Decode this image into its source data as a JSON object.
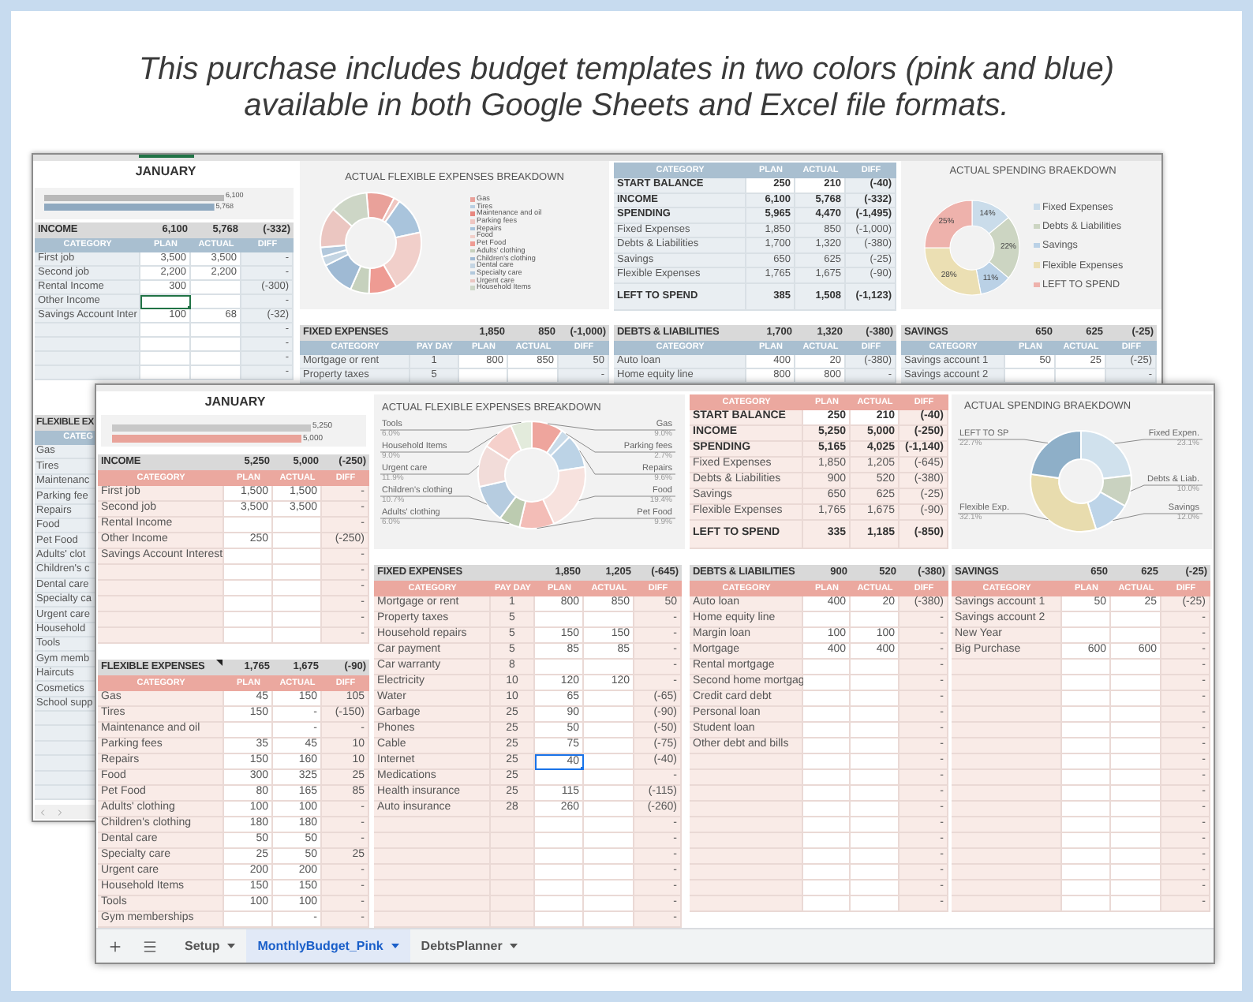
{
  "header": {
    "text": "This purchase includes budget templates in two colors (pink and blue) available in both Google Sheets and Excel file formats."
  },
  "back_sheet": {
    "title": "JANUARY",
    "income_chart": {
      "chart_data": {
        "type": "bar",
        "orientation": "horizontal",
        "categories": [
          null,
          null
        ],
        "values": [
          6100,
          5768
        ],
        "colors": [
          "#b9b9b9",
          "#8fa9c0"
        ],
        "value_labels": [
          "6,100",
          "5,768"
        ]
      }
    },
    "income": {
      "title": "INCOME",
      "totals": [
        "6,100",
        "5,768",
        "(-332)"
      ],
      "columns": [
        "CATEGORY",
        "PLAN",
        "ACTUAL",
        "DIFF"
      ],
      "rows": [
        {
          "category": "First job",
          "plan": "3,500",
          "actual": "3,500",
          "diff": "-"
        },
        {
          "category": "Second job",
          "plan": "2,200",
          "actual": "2,200",
          "diff": "-"
        },
        {
          "category": "Rental Income",
          "plan": "300",
          "diff": "(-300)"
        },
        {
          "category": "Other Income",
          "diff": "-",
          "plan_selected": true
        },
        {
          "category": "Savings Account Inter",
          "plan": "100",
          "actual": "68",
          "diff": "(-32)"
        },
        {
          "diff": "-"
        },
        {
          "diff": "-"
        },
        {
          "diff": "-"
        },
        {
          "diff": "-"
        }
      ]
    },
    "flexible_chart": {
      "title": "ACTUAL FLEXIBLE EXPENSES BREAKDOWN",
      "legend": [
        {
          "label": "Gas",
          "color": "#e9a19a"
        },
        {
          "label": "Tires",
          "color": "#b9cfe2"
        },
        {
          "label": "Maintenance and oil",
          "color": "#e8877f"
        },
        {
          "label": "Parking fees",
          "color": "#efc6c1"
        },
        {
          "label": "Repairs",
          "color": "#a9c4dc"
        },
        {
          "label": "Food",
          "color": "#f1cfca"
        },
        {
          "label": "Pet Food",
          "color": "#ee9b93"
        },
        {
          "label": "Adults' clothing",
          "color": "#c6d1bd"
        },
        {
          "label": "Children's clothing",
          "color": "#9fbad4"
        },
        {
          "label": "Dental care",
          "color": "#c4d5e3"
        },
        {
          "label": "Specialty care",
          "color": "#b2c8dc"
        },
        {
          "label": "Urgent care",
          "color": "#ebc6c1"
        },
        {
          "label": "Household Items",
          "color": "#cdd6c6"
        }
      ]
    },
    "fixed": {
      "title": "FIXED EXPENSES",
      "totals": [
        "1,850",
        "850",
        "(-1,000)"
      ],
      "columns": [
        "CATEGORY",
        "PAY DAY",
        "PLAN",
        "ACTUAL",
        "DIFF"
      ],
      "rows": [
        {
          "category": "Mortgage or rent",
          "pay_day": "1",
          "plan": "800",
          "actual": "850",
          "diff": "50"
        },
        {
          "category": "Property taxes",
          "pay_day": "5",
          "diff": "-"
        }
      ]
    },
    "summary": {
      "columns": [
        "CATEGORY",
        "PLAN",
        "ACTUAL",
        "DIFF"
      ],
      "rows": [
        {
          "kind": "input",
          "category": "START BALANCE",
          "plan": "250",
          "actual": "210",
          "diff": "(-40)"
        },
        {
          "kind": "main",
          "category": "INCOME",
          "plan": "6,100",
          "actual": "5,768",
          "diff": "(-332)"
        },
        {
          "kind": "main",
          "category": "SPENDING",
          "plan": "5,965",
          "actual": "4,470",
          "diff": "(-1,495)"
        },
        {
          "kind": "sub",
          "category": "Fixed Expenses",
          "plan": "1,850",
          "actual": "850",
          "diff": "(-1,000)"
        },
        {
          "kind": "sub",
          "category": "Debts & Liabilities",
          "plan": "1,700",
          "actual": "1,320",
          "diff": "(-380)"
        },
        {
          "kind": "sub",
          "category": "Savings",
          "plan": "650",
          "actual": "625",
          "diff": "(-25)"
        },
        {
          "kind": "sub",
          "category": "Flexible Expenses",
          "plan": "1,765",
          "actual": "1,675",
          "diff": "(-90)"
        },
        {
          "kind": "result",
          "category": "LEFT TO SPEND",
          "plan": "385",
          "actual": "1,508",
          "diff": "(-1,123)"
        }
      ]
    },
    "spending_chart": {
      "title": "ACTUAL SPENDING BRAEKDOWN",
      "chart_data": {
        "type": "donut",
        "legend": "right",
        "categories": [
          "Fixed Expenses",
          "Debts & Liabilities",
          "Savings",
          "Flexible Expenses",
          "LEFT TO SPEND"
        ],
        "values": [
          14,
          22,
          11,
          28,
          25
        ],
        "colors": [
          "#cadcea",
          "#ccd5c2",
          "#bad1e6",
          "#ebdfb3",
          "#eeb2ac"
        ],
        "value_labels": [
          "14%",
          "22%",
          "11%",
          "28%",
          "25%"
        ]
      }
    },
    "debts": {
      "title": "DEBTS & LIABILITIES",
      "totals": [
        "1,700",
        "1,320",
        "(-380)"
      ],
      "columns": [
        "CATEGORY",
        "PLAN",
        "ACTUAL",
        "DIFF"
      ],
      "rows": [
        {
          "category": "Auto loan",
          "plan": "400",
          "actual": "20",
          "diff": "(-380)"
        },
        {
          "category": "Home equity line",
          "plan": "800",
          "actual": "800",
          "diff": "-"
        }
      ]
    },
    "savings": {
      "title": "SAVINGS",
      "totals": [
        "650",
        "625",
        "(-25)"
      ],
      "columns": [
        "CATEGORY",
        "PLAN",
        "ACTUAL",
        "DIFF"
      ],
      "rows": [
        {
          "category": "Savings account 1",
          "plan": "50",
          "actual": "25",
          "diff": "(-25)"
        },
        {
          "category": "Savings account 2",
          "diff": "-"
        }
      ]
    },
    "flexible": {
      "title": "FLEXIBLE EX",
      "columns": [
        "CATEG"
      ],
      "rows": [
        "Gas",
        "Tires",
        "Maintenanc",
        "Parking fee",
        "Repairs",
        "Food",
        "Pet Food",
        "Adults' clot",
        "Children's c",
        "Dental care",
        "Specialty ca",
        "Urgent care",
        "Household",
        "Tools",
        "Gym memb",
        "Haircuts",
        "Cosmetics",
        "School supp"
      ]
    }
  },
  "front_sheet": {
    "title": "JANUARY",
    "income_chart": {
      "chart_data": {
        "type": "bar",
        "orientation": "horizontal",
        "categories": [
          null,
          null
        ],
        "values": [
          5250,
          5000
        ],
        "colors": [
          "#c8c8c8",
          "#e9a39a"
        ],
        "value_labels": [
          "5,250",
          "5,000"
        ]
      }
    },
    "income": {
      "title": "INCOME",
      "totals": [
        "5,250",
        "5,000",
        "(-250)"
      ],
      "columns": [
        "CATEGORY",
        "PLAN",
        "ACTUAL",
        "DIFF"
      ],
      "rows": [
        {
          "category": "First job",
          "plan": "1,500",
          "actual": "1,500",
          "diff": "-"
        },
        {
          "category": "Second job",
          "plan": "3,500",
          "actual": "3,500",
          "diff": "-"
        },
        {
          "category": "Rental Income",
          "diff": "-"
        },
        {
          "category": "Other Income",
          "plan": "250",
          "diff": "(-250)"
        },
        {
          "category": "Savings Account Interest",
          "diff": "-"
        },
        {
          "diff": "-"
        },
        {
          "diff": "-"
        },
        {
          "diff": "-"
        },
        {
          "diff": "-"
        },
        {
          "diff": "-"
        }
      ]
    },
    "flexible": {
      "title": "FLEXIBLE EXPENSES",
      "totals": [
        "1,765",
        "1,675",
        "(-90)"
      ],
      "columns": [
        "CATEGORY",
        "PLAN",
        "ACTUAL",
        "DIFF"
      ],
      "rows": [
        {
          "category": "Gas",
          "plan": "45",
          "actual": "150",
          "diff": "105"
        },
        {
          "category": "Tires",
          "plan": "150",
          "actual": "-",
          "diff": "(-150)"
        },
        {
          "category": "Maintenance and oil",
          "actual": "-",
          "diff": "-"
        },
        {
          "category": "Parking fees",
          "plan": "35",
          "actual": "45",
          "diff": "10"
        },
        {
          "category": "Repairs",
          "plan": "150",
          "actual": "160",
          "diff": "10"
        },
        {
          "category": "Food",
          "plan": "300",
          "actual": "325",
          "diff": "25"
        },
        {
          "category": "Pet Food",
          "plan": "80",
          "actual": "165",
          "diff": "85"
        },
        {
          "category": "Adults' clothing",
          "plan": "100",
          "actual": "100",
          "diff": "-"
        },
        {
          "category": "Children's clothing",
          "plan": "180",
          "actual": "180",
          "diff": "-"
        },
        {
          "category": "Dental care",
          "plan": "50",
          "actual": "50",
          "diff": "-"
        },
        {
          "category": "Specialty care",
          "plan": "25",
          "actual": "50",
          "diff": "25"
        },
        {
          "category": "Urgent care",
          "plan": "200",
          "actual": "200",
          "diff": "-"
        },
        {
          "category": "Household Items",
          "plan": "150",
          "actual": "150",
          "diff": "-"
        },
        {
          "category": "Tools",
          "plan": "100",
          "actual": "100",
          "diff": "-"
        },
        {
          "category": "Gym memberships",
          "actual": "-",
          "diff": "-"
        }
      ]
    },
    "flexible_chart": {
      "title": "ACTUAL FLEXIBLE EXPENSES BREAKDOWN",
      "chart_data": {
        "type": "donut",
        "categories": [
          "Gas",
          "Parking fees",
          "Repairs",
          "Food",
          "Pet Food",
          "Adults' clothing",
          "Children's clothing",
          "Urgent care",
          "Household Items",
          "Tools"
        ],
        "values": [
          9.0,
          2.7,
          9.6,
          19.4,
          9.9,
          6.0,
          10.7,
          11.9,
          9.0,
          6.0
        ],
        "colors": [
          "#eea59d",
          "#c9dbe9",
          "#bcd3e6",
          "#f7e2de",
          "#f3bdb7",
          "#bccbb0",
          "#b6cce0",
          "#f2dcd9",
          "#f5d0cb",
          "#e3ebdc"
        ],
        "value_labels": [
          "9.0%",
          "2.7%",
          "9.6%",
          "19.4%",
          "9.9%",
          "6.0%",
          "10.7%",
          "11.9%",
          "9.0%",
          "6.0%"
        ]
      }
    },
    "fixed": {
      "title": "FIXED EXPENSES",
      "totals": [
        "1,850",
        "1,205",
        "(-645)"
      ],
      "columns": [
        "CATEGORY",
        "PAY DAY",
        "PLAN",
        "ACTUAL",
        "DIFF"
      ],
      "rows": [
        {
          "category": "Mortgage or rent",
          "pay_day": "1",
          "plan": "800",
          "actual": "850",
          "diff": "50"
        },
        {
          "category": "Property taxes",
          "pay_day": "5",
          "diff": "-"
        },
        {
          "category": "Household repairs",
          "pay_day": "5",
          "plan": "150",
          "actual": "150",
          "diff": "-"
        },
        {
          "category": "Car payment",
          "pay_day": "5",
          "plan": "85",
          "actual": "85",
          "diff": "-"
        },
        {
          "category": "Car warranty",
          "pay_day": "8",
          "diff": "-"
        },
        {
          "category": "Electricity",
          "pay_day": "10",
          "plan": "120",
          "actual": "120",
          "diff": "-"
        },
        {
          "category": "Water",
          "pay_day": "10",
          "plan": "65",
          "diff": "(-65)"
        },
        {
          "category": "Garbage",
          "pay_day": "25",
          "plan": "90",
          "diff": "(-90)"
        },
        {
          "category": "Phones",
          "pay_day": "25",
          "plan": "50",
          "diff": "(-50)"
        },
        {
          "category": "Cable",
          "pay_day": "25",
          "plan": "75",
          "diff": "(-75)"
        },
        {
          "category": "Internet",
          "pay_day": "25",
          "plan": "40",
          "diff": "(-40)",
          "plan_selected": true
        },
        {
          "category": "Medications",
          "pay_day": "25",
          "diff": "-"
        },
        {
          "category": "Health insurance",
          "pay_day": "25",
          "plan": "115",
          "diff": "(-115)"
        },
        {
          "category": "Auto insurance",
          "pay_day": "28",
          "plan": "260",
          "diff": "(-260)"
        },
        {
          "diff": "-"
        },
        {
          "diff": "-"
        },
        {
          "diff": "-"
        },
        {
          "diff": "-"
        },
        {
          "diff": "-"
        },
        {
          "diff": "-"
        },
        {
          "diff": "-"
        }
      ]
    },
    "summary": {
      "columns": [
        "CATEGORY",
        "PLAN",
        "ACTUAL",
        "DIFF"
      ],
      "rows": [
        {
          "kind": "input",
          "category": "START BALANCE",
          "plan": "250",
          "actual": "210",
          "diff": "(-40)"
        },
        {
          "kind": "main",
          "category": "INCOME",
          "plan": "5,250",
          "actual": "5,000",
          "diff": "(-250)"
        },
        {
          "kind": "main",
          "category": "SPENDING",
          "plan": "5,165",
          "actual": "4,025",
          "diff": "(-1,140)"
        },
        {
          "kind": "sub",
          "category": "Fixed Expenses",
          "plan": "1,850",
          "actual": "1,205",
          "diff": "(-645)"
        },
        {
          "kind": "sub",
          "category": "Debts & Liabilities",
          "plan": "900",
          "actual": "520",
          "diff": "(-380)"
        },
        {
          "kind": "sub",
          "category": "Savings",
          "plan": "650",
          "actual": "625",
          "diff": "(-25)"
        },
        {
          "kind": "sub",
          "category": "Flexible Expenses",
          "plan": "1,765",
          "actual": "1,675",
          "diff": "(-90)"
        },
        {
          "kind": "result",
          "category": "LEFT TO SPEND",
          "plan": "335",
          "actual": "1,185",
          "diff": "(-850)"
        }
      ]
    },
    "spending_chart": {
      "title": "ACTUAL SPENDING BRAEKDOWN",
      "chart_data": {
        "type": "donut",
        "categories": [
          "Fixed Expen.",
          "Debts & Liab.",
          "Savings",
          "Flexible Exp.",
          "LEFT TO SP"
        ],
        "values": [
          23.1,
          10.0,
          12.0,
          32.1,
          22.7
        ],
        "colors": [
          "#d0e1ed",
          "#c9d2c0",
          "#bdd4e8",
          "#e8dcae",
          "#8eafc8"
        ],
        "value_labels": [
          "23.1%",
          "10.0%",
          "12.0%",
          "32.1%",
          "22.7%"
        ]
      }
    },
    "debts": {
      "title": "DEBTS & LIABILITIES",
      "totals": [
        "900",
        "520",
        "(-380)"
      ],
      "columns": [
        "CATEGORY",
        "PLAN",
        "ACTUAL",
        "DIFF"
      ],
      "rows": [
        {
          "category": "Auto loan",
          "plan": "400",
          "actual": "20",
          "diff": "(-380)"
        },
        {
          "category": "Home equity line",
          "diff": "-"
        },
        {
          "category": "Margin loan",
          "plan": "100",
          "actual": "100",
          "diff": "-"
        },
        {
          "category": "Mortgage",
          "plan": "400",
          "actual": "400",
          "diff": "-"
        },
        {
          "category": "Rental mortgage",
          "diff": "-"
        },
        {
          "category": "Second home mortgag",
          "diff": "-"
        },
        {
          "category": "Credit card debt",
          "diff": "-"
        },
        {
          "category": "Personal loan",
          "diff": "-"
        },
        {
          "category": "Student loan",
          "diff": "-"
        },
        {
          "category": "Other debt and bills",
          "diff": "-"
        },
        {
          "diff": "-"
        },
        {
          "diff": "-"
        },
        {
          "diff": "-"
        },
        {
          "diff": "-"
        },
        {
          "diff": "-"
        },
        {
          "diff": "-"
        },
        {
          "diff": "-"
        },
        {
          "diff": "-"
        },
        {
          "diff": "-"
        },
        {
          "diff": "-"
        }
      ]
    },
    "savings": {
      "title": "SAVINGS",
      "totals": [
        "650",
        "625",
        "(-25)"
      ],
      "columns": [
        "CATEGORY",
        "PLAN",
        "ACTUAL",
        "DIFF"
      ],
      "rows": [
        {
          "category": "Savings account 1",
          "plan": "50",
          "actual": "25",
          "diff": "(-25)"
        },
        {
          "category": "Savings account 2",
          "diff": "-"
        },
        {
          "category": "New Year",
          "diff": "-"
        },
        {
          "category": "Big Purchase",
          "plan": "600",
          "actual": "600",
          "diff": "-"
        },
        {
          "diff": "-"
        },
        {
          "diff": "-"
        },
        {
          "diff": "-"
        },
        {
          "diff": "-"
        },
        {
          "diff": "-"
        },
        {
          "diff": "-"
        },
        {
          "diff": "-"
        },
        {
          "diff": "-"
        },
        {
          "diff": "-"
        },
        {
          "diff": "-"
        },
        {
          "diff": "-"
        },
        {
          "diff": "-"
        },
        {
          "diff": "-"
        },
        {
          "diff": "-"
        },
        {
          "diff": "-"
        },
        {
          "diff": "-"
        }
      ]
    },
    "sheet_tabs": [
      {
        "label": "Setup",
        "selected": false
      },
      {
        "label": "MonthlyBudget_Pink",
        "selected": true
      },
      {
        "label": "DebtsPlanner",
        "selected": false
      }
    ]
  }
}
